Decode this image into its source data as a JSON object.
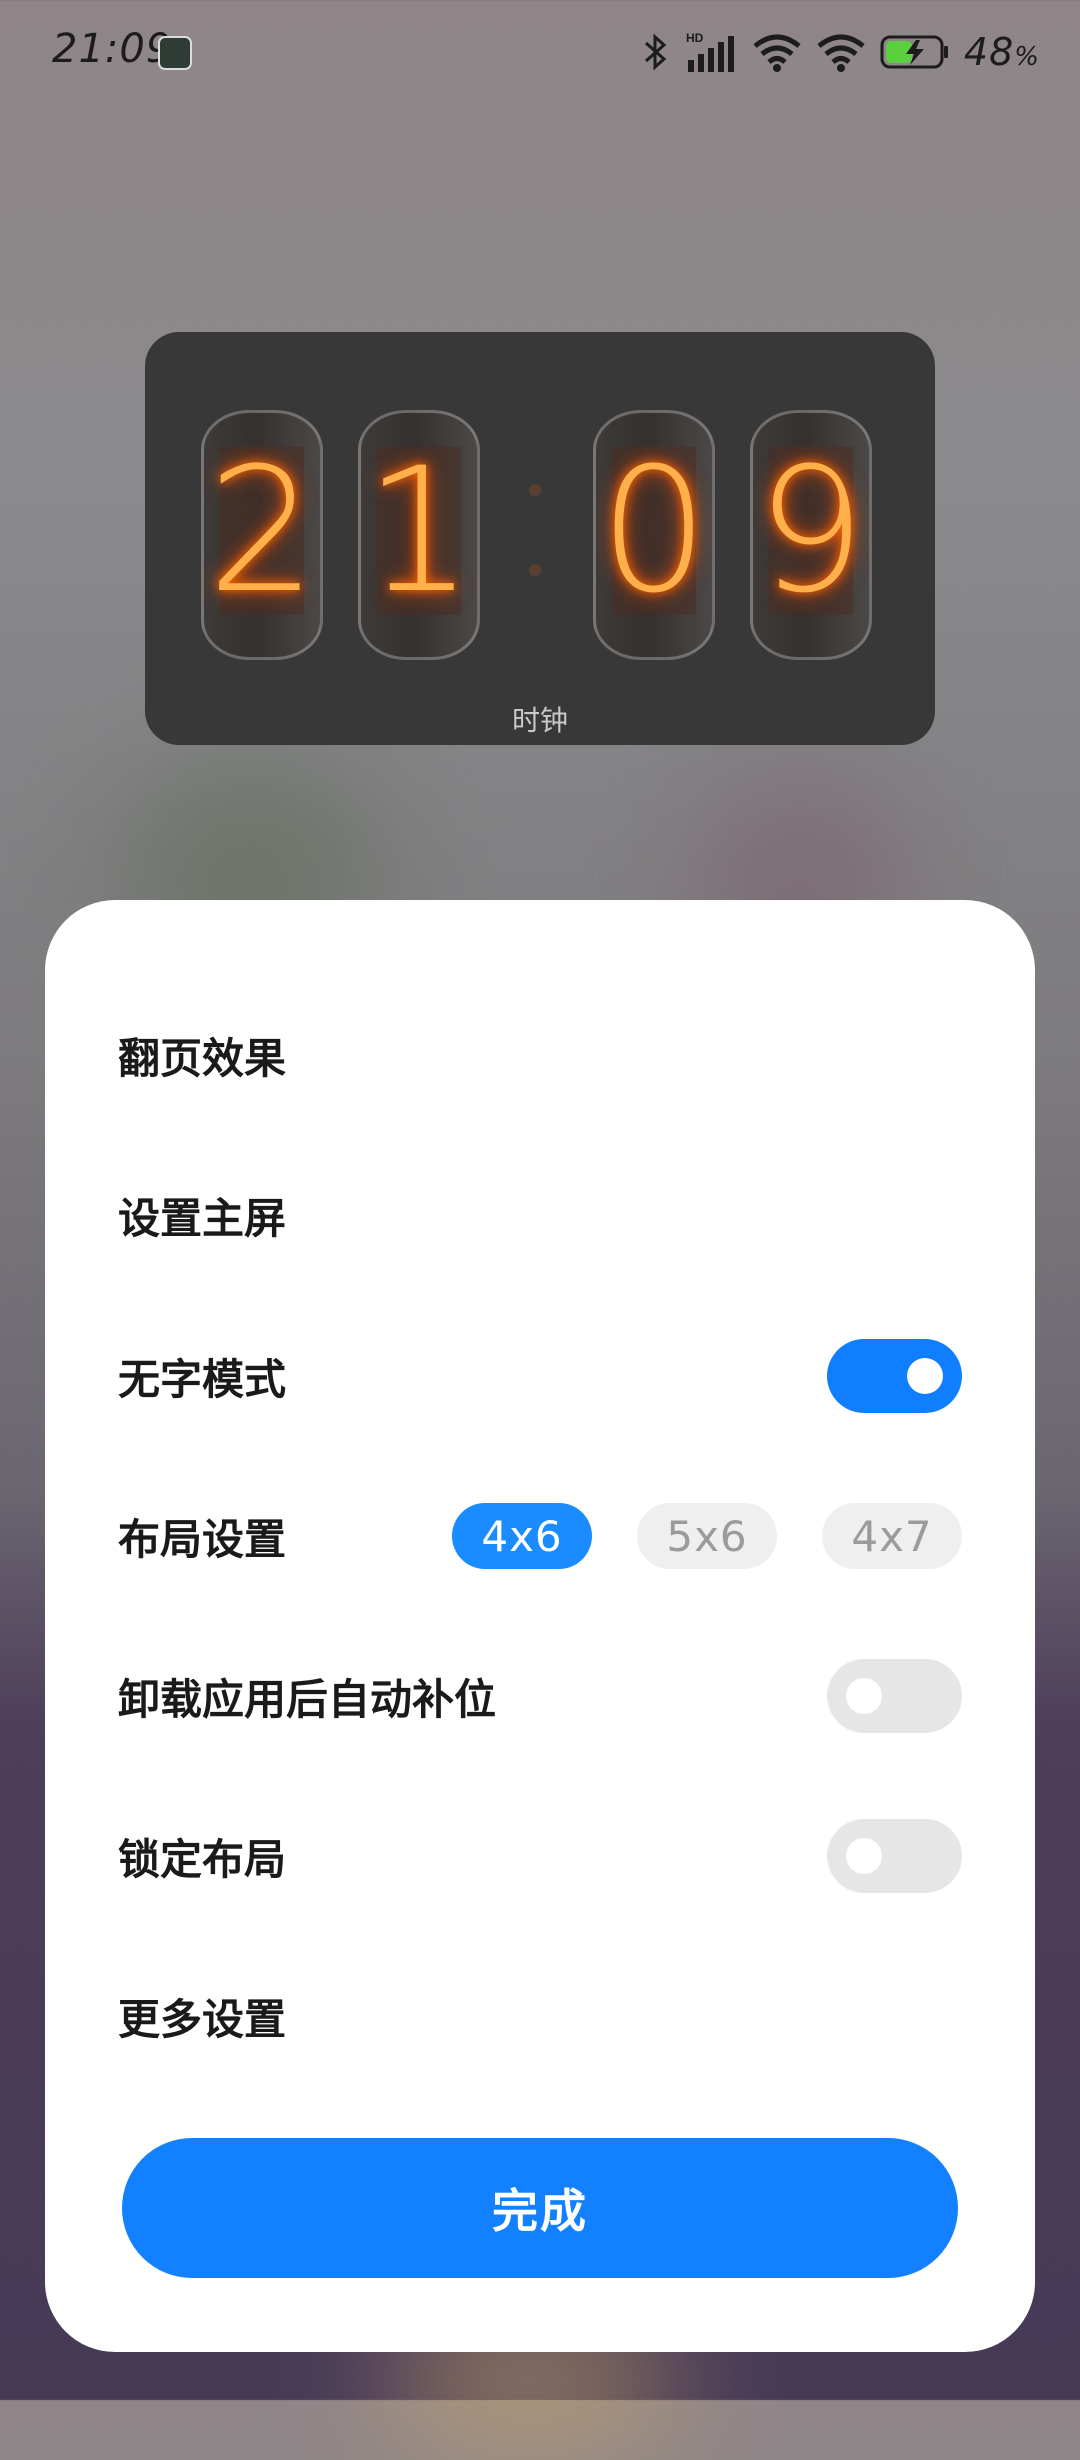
{
  "status_bar": {
    "time": "21:09",
    "battery_text": "48",
    "battery_unit": "%",
    "hd_label": "HD",
    "icons": [
      "app-notification-icon",
      "bluetooth-icon",
      "cellular-signal-icon",
      "wifi-icon",
      "wifi-icon",
      "battery-charging-icon"
    ]
  },
  "clock_widget": {
    "digits": [
      "2",
      "1",
      "0",
      "9"
    ],
    "label": "时钟"
  },
  "settings": {
    "page_flip_effect": "翻页效果",
    "set_home_screen": "设置主屏",
    "no_text_mode": "无字模式",
    "no_text_mode_on": true,
    "layout_settings": "布局设置",
    "layout_options": [
      "4x6",
      "5x6",
      "4x7"
    ],
    "layout_selected": "4x6",
    "auto_fill_after_uninstall": "卸载应用后自动补位",
    "auto_fill_on": false,
    "lock_layout": "锁定布局",
    "lock_layout_on": false,
    "more_settings": "更多设置",
    "done_button": "完成"
  },
  "colors": {
    "accent": "#0f7fff",
    "nixie_glow": "#ffb04a",
    "sheet_bg": "#ffffff"
  }
}
